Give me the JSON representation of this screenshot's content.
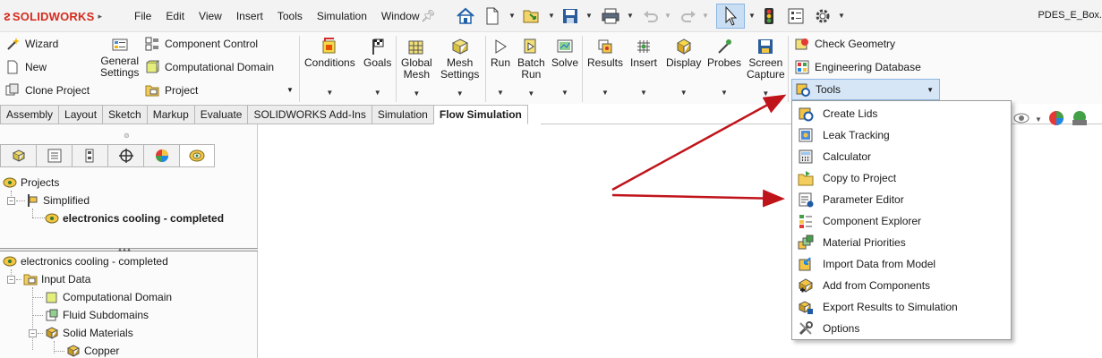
{
  "app": {
    "brand": "SOLIDWORKS",
    "document_title": "PDES_E_Box."
  },
  "menu": [
    "File",
    "Edit",
    "View",
    "Insert",
    "Tools",
    "Simulation",
    "Window"
  ],
  "ribbon": {
    "left_group": [
      "Wizard",
      "New",
      "Clone Project"
    ],
    "general_settings": "General\nSettings",
    "settings_group": [
      "Component Control",
      "Computational Domain",
      "Project"
    ],
    "buttons": [
      {
        "label": "Conditions"
      },
      {
        "label": "Goals"
      },
      {
        "label": "Global\nMesh"
      },
      {
        "label": "Mesh\nSettings"
      },
      {
        "label": "Run"
      },
      {
        "label": "Batch\nRun"
      },
      {
        "label": "Solve"
      },
      {
        "label": "Results"
      },
      {
        "label": "Insert"
      },
      {
        "label": "Display"
      },
      {
        "label": "Probes"
      },
      {
        "label": "Screen\nCapture"
      }
    ],
    "right_group": [
      "Check Geometry",
      "Engineering Database"
    ],
    "tools_label": "Tools"
  },
  "tabs": [
    "Assembly",
    "Layout",
    "Sketch",
    "Markup",
    "Evaluate",
    "SOLIDWORKS Add-Ins",
    "Simulation",
    "Flow Simulation"
  ],
  "active_tab": "Flow Simulation",
  "tree_top": {
    "projects": "Projects",
    "simplified": "Simplified",
    "project_name": "electronics cooling - completed"
  },
  "tree_bottom": {
    "root": "electronics cooling - completed",
    "input_data": "Input Data",
    "items": [
      "Computational Domain",
      "Fluid Subdomains",
      "Solid Materials"
    ],
    "copper": "Copper"
  },
  "tools_menu": [
    {
      "label": "Create Lids",
      "icon": "create-lids-icon"
    },
    {
      "label": "Leak Tracking",
      "icon": "leak-tracking-icon"
    },
    {
      "label": "Calculator",
      "icon": "calculator-icon"
    },
    {
      "label": "Copy to Project",
      "icon": "copy-to-project-icon"
    },
    {
      "label": "Parameter Editor",
      "icon": "parameter-editor-icon"
    },
    {
      "label": "Component Explorer",
      "icon": "component-explorer-icon"
    },
    {
      "label": "Material Priorities",
      "icon": "material-priorities-icon"
    },
    {
      "label": "Import Data from Model",
      "icon": "import-data-icon"
    },
    {
      "label": "Add from Components",
      "icon": "add-from-components-icon"
    },
    {
      "label": "Export Results to Simulation",
      "icon": "export-results-icon"
    },
    {
      "label": "Options",
      "icon": "options-icon"
    }
  ],
  "colors": {
    "brand_red": "#d52b1e",
    "annotation_arrow": "#c0141b",
    "highlight": "#d7e6f7",
    "highlight_border": "#8eb6e1"
  }
}
